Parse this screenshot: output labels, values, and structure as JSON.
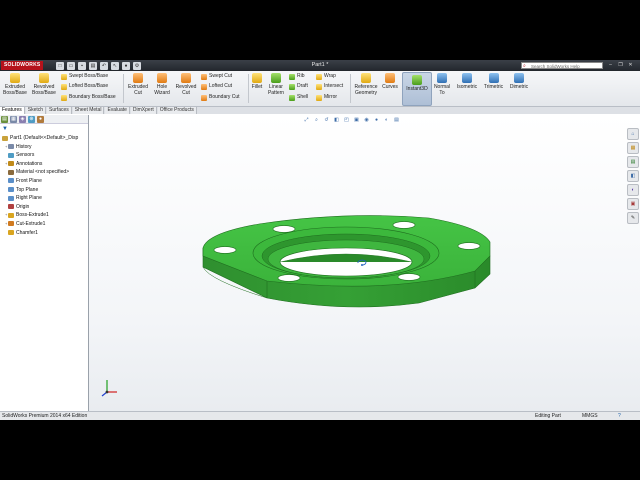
{
  "app": {
    "logo": "SOLIDWORKS",
    "document_title": "Part1 *",
    "help_search_placeholder": "Search SolidWorks Help"
  },
  "quick_access": [
    "new-icon",
    "open-icon",
    "save-icon",
    "print-icon",
    "undo-icon",
    "select-icon",
    "rebuild-icon",
    "options-icon"
  ],
  "ribbon": {
    "extruded_boss": "Extruded\nBoss/Base",
    "revolved_boss": "Revolved\nBoss/Base",
    "swept_boss": "Swept Boss/Base",
    "lofted_boss": "Lofted Boss/Base",
    "boundary_boss": "Boundary Boss/Base",
    "extruded_cut": "Extruded\nCut",
    "hole_wizard": "Hole\nWizard",
    "revolved_cut": "Revolved\nCut",
    "swept_cut": "Swept Cut",
    "lofted_cut": "Lofted Cut",
    "boundary_cut": "Boundary Cut",
    "fillet": "Fillet",
    "linear_pattern": "Linear\nPattern",
    "rib": "Rib",
    "draft": "Draft",
    "shell": "Shell",
    "wrap": "Wrap",
    "intersect": "Intersect",
    "mirror": "Mirror",
    "reference_geometry": "Reference\nGeometry",
    "curves": "Curves",
    "instant3d": "Instant3D",
    "normal_to": "Normal\nTo",
    "isometric": "Isometric",
    "trimetric": "Trimetric",
    "dimetric": "Dimetric"
  },
  "tabs": [
    "Features",
    "Sketch",
    "Surfaces",
    "Sheet Metal",
    "Evaluate",
    "DimXpert",
    "Office Products"
  ],
  "active_tab": "Features",
  "feature_tree": [
    {
      "label": "Part1  (Default<<Default>_Disp",
      "icon": "part-icon",
      "indent": 0,
      "expander": ""
    },
    {
      "label": "History",
      "icon": "history-icon",
      "indent": 1,
      "expander": "+"
    },
    {
      "label": "Sensors",
      "icon": "sensors-icon",
      "indent": 1,
      "expander": ""
    },
    {
      "label": "Annotations",
      "icon": "annotations-icon",
      "indent": 1,
      "expander": "+"
    },
    {
      "label": "Material <not specified>",
      "icon": "material-icon",
      "indent": 1,
      "expander": ""
    },
    {
      "label": "Front Plane",
      "icon": "plane-icon",
      "indent": 1,
      "expander": ""
    },
    {
      "label": "Top Plane",
      "icon": "plane-icon",
      "indent": 1,
      "expander": ""
    },
    {
      "label": "Right Plane",
      "icon": "plane-icon",
      "indent": 1,
      "expander": ""
    },
    {
      "label": "Origin",
      "icon": "origin-icon",
      "indent": 1,
      "expander": ""
    },
    {
      "label": "Boss-Extrude1",
      "icon": "boss-extrude-icon",
      "indent": 1,
      "expander": "+"
    },
    {
      "label": "Cut-Extrude1",
      "icon": "cut-extrude-icon",
      "indent": 1,
      "expander": "+"
    },
    {
      "label": "Chamfer1",
      "icon": "chamfer-icon",
      "indent": 1,
      "expander": ""
    }
  ],
  "status": {
    "edition": "SolidWorks Premium 2014 x64 Edition",
    "mode": "Editing Part",
    "units": "MMGS",
    "help": "?"
  },
  "colors": {
    "part": "#3fbf3f",
    "part_dark": "#2c8f2c",
    "brand": "#b5121b"
  }
}
